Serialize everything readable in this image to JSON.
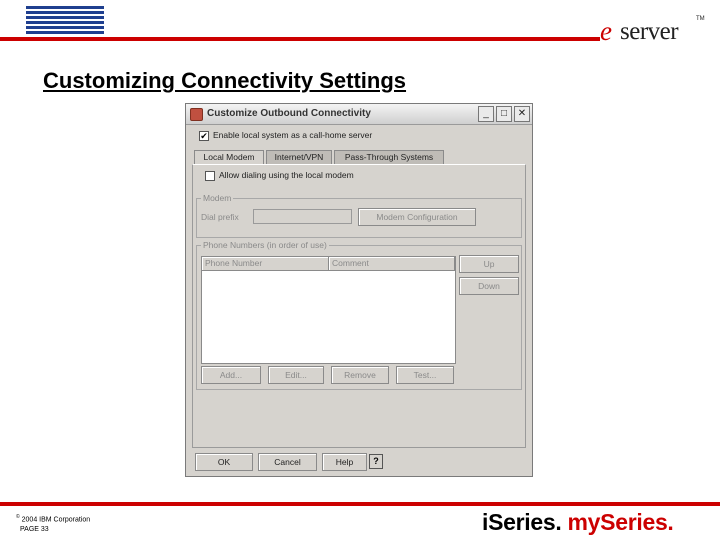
{
  "slide": {
    "title": "Customizing Connectivity Settings",
    "copyright": "2004 IBM Corporation",
    "copyright_symbol": "©",
    "page": "PAGE 33",
    "brand_left": "iSeries.",
    "brand_right": "mySeries.",
    "ibm_logo": "IBM",
    "eserver_e": "e",
    "eserver_text": "server",
    "eserver_tm": "TM",
    "colors": {
      "accent": "#cc0000"
    }
  },
  "dialog": {
    "title": "Customize Outbound Connectivity",
    "window_buttons": {
      "minimize": "_",
      "maximize": "□",
      "close": "✕"
    },
    "enable_label": "Enable local system as a call-home server",
    "enable_checked": true,
    "tabs": [
      {
        "label": "Local Modem",
        "active": true
      },
      {
        "label": "Internet/VPN",
        "active": false
      },
      {
        "label": "Pass-Through Systems",
        "active": false
      }
    ],
    "allow_dialing_label": "Allow dialing using the local modem",
    "allow_dialing_checked": false,
    "modem_group": {
      "title": "Modem",
      "dial_prefix_label": "Dial prefix",
      "dial_prefix_value": "",
      "config_button": "Modem Configuration"
    },
    "phone_group": {
      "title": "Phone Numbers (in order of use)",
      "columns": [
        "Phone Number",
        "Comment"
      ],
      "rows": [],
      "up_button": "Up",
      "down_button": "Down",
      "add_button": "Add...",
      "edit_button": "Edit...",
      "remove_button": "Remove",
      "test_button": "Test..."
    },
    "footer": {
      "ok": "OK",
      "cancel": "Cancel",
      "help": "Help",
      "question": "?"
    }
  }
}
